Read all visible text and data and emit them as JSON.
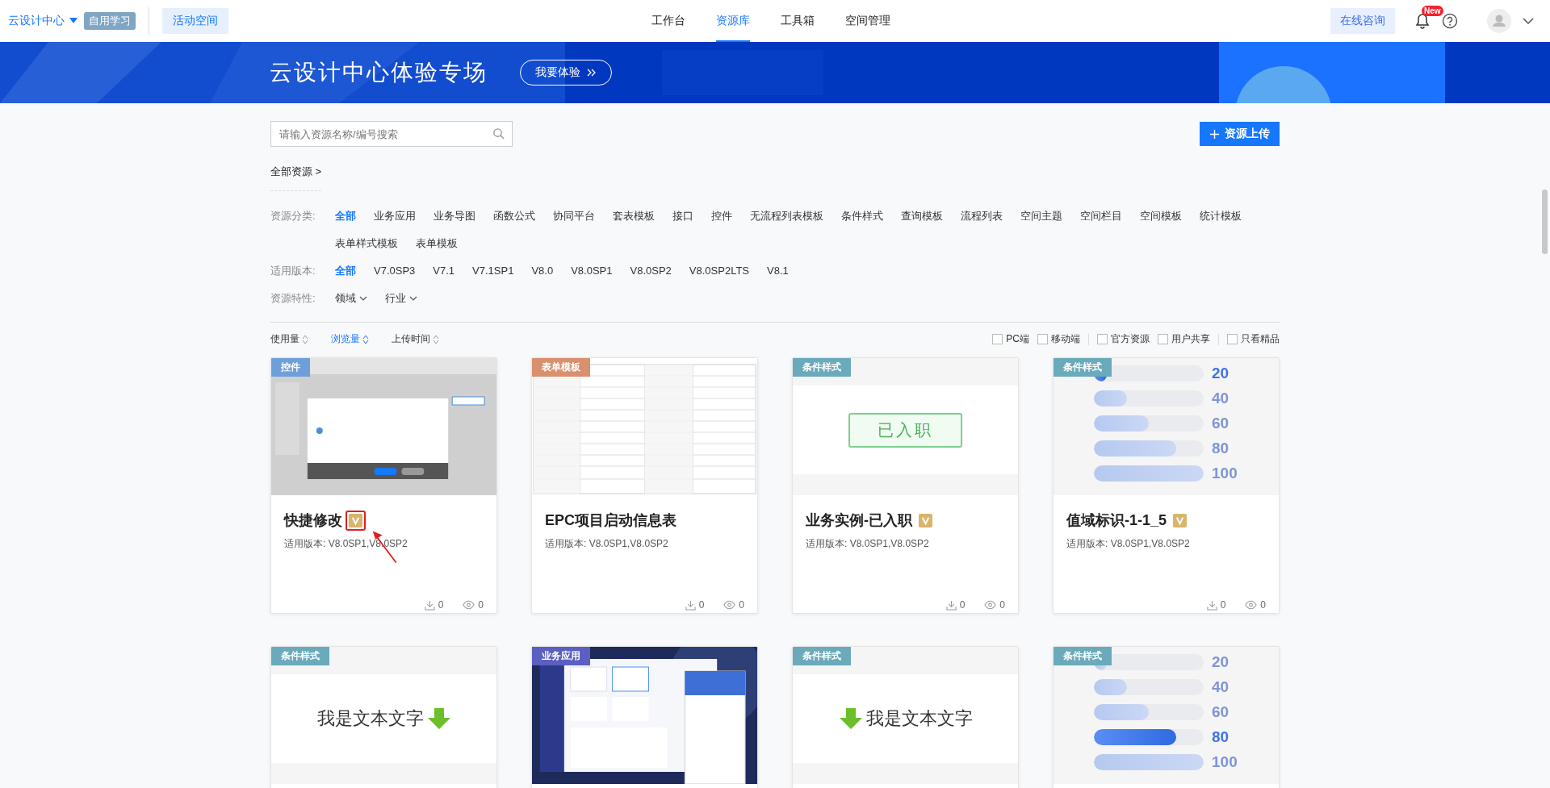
{
  "topbar": {
    "brand": "云设计中心",
    "brand_tag": "自用学习",
    "space_button": "活动空间",
    "nav": [
      {
        "label": "工作台",
        "selected": false
      },
      {
        "label": "资源库",
        "selected": true
      },
      {
        "label": "工具箱",
        "selected": false
      },
      {
        "label": "空间管理",
        "selected": false
      }
    ],
    "consult_button": "在线咨询",
    "bell_badge": "New"
  },
  "banner": {
    "title": "云设计中心体验专场",
    "button": "我要体验"
  },
  "search": {
    "placeholder": "请输入资源名称/编号搜索"
  },
  "upload_button": "资源上传",
  "breadcrumb": "全部资源 >",
  "filters": [
    {
      "label": "资源分类:",
      "kind": "tags",
      "options": [
        {
          "label": "全部",
          "selected": true
        },
        {
          "label": "业务应用",
          "selected": false
        },
        {
          "label": "业务导图",
          "selected": false
        },
        {
          "label": "函数公式",
          "selected": false
        },
        {
          "label": "协同平台",
          "selected": false
        },
        {
          "label": "套表模板",
          "selected": false
        },
        {
          "label": "接口",
          "selected": false
        },
        {
          "label": "控件",
          "selected": false
        },
        {
          "label": "无流程列表模板",
          "selected": false
        },
        {
          "label": "条件样式",
          "selected": false
        },
        {
          "label": "查询模板",
          "selected": false
        },
        {
          "label": "流程列表",
          "selected": false
        },
        {
          "label": "空间主题",
          "selected": false
        },
        {
          "label": "空间栏目",
          "selected": false
        },
        {
          "label": "空间模板",
          "selected": false
        },
        {
          "label": "统计模板",
          "selected": false
        },
        {
          "label": "表单样式模板",
          "selected": false
        },
        {
          "label": "表单模板",
          "selected": false
        }
      ]
    },
    {
      "label": "适用版本:",
      "kind": "tags",
      "options": [
        {
          "label": "全部",
          "selected": true
        },
        {
          "label": "V7.0SP3",
          "selected": false
        },
        {
          "label": "V7.1",
          "selected": false
        },
        {
          "label": "V7.1SP1",
          "selected": false
        },
        {
          "label": "V8.0",
          "selected": false
        },
        {
          "label": "V8.0SP1",
          "selected": false
        },
        {
          "label": "V8.0SP2",
          "selected": false
        },
        {
          "label": "V8.0SP2LTS",
          "selected": false
        },
        {
          "label": "V8.1",
          "selected": false
        }
      ]
    },
    {
      "label": "资源特性:",
      "kind": "dropdowns",
      "options": [
        {
          "label": "领域",
          "selected": false
        },
        {
          "label": "行业",
          "selected": false
        }
      ]
    }
  ],
  "sort": [
    {
      "label": "使用量",
      "selected": false
    },
    {
      "label": "浏览量",
      "selected": true
    },
    {
      "label": "上传时间",
      "selected": false
    }
  ],
  "checkbox_groups": [
    [
      {
        "label": "PC端",
        "checked": false
      },
      {
        "label": "移动端",
        "checked": false
      }
    ],
    [
      {
        "label": "官方资源",
        "checked": false
      },
      {
        "label": "用户共享",
        "checked": false
      }
    ],
    [
      {
        "label": "只看精品",
        "checked": false
      }
    ]
  ],
  "cards": [
    {
      "tag": "控件",
      "color": "#6f9fd8",
      "thumb": {
        "kind": "screen"
      },
      "title": "快捷修改",
      "premium": true,
      "annotated": true,
      "version": "适用版本:  V8.0SP1,V8.0SP2",
      "downloads": "0",
      "views": "0"
    },
    {
      "tag": "表单模板",
      "color": "#d9906f",
      "thumb": {
        "kind": "form"
      },
      "title": "EPC项目启动信息表",
      "premium": false,
      "annotated": false,
      "version": "适用版本:  V8.0SP1,V8.0SP2",
      "downloads": "0",
      "views": "0"
    },
    {
      "tag": "条件样式",
      "color": "#6aaabb",
      "thumb": {
        "kind": "status",
        "text": "已入职"
      },
      "title": "业务实例-已入职",
      "premium": true,
      "annotated": false,
      "version": "适用版本:  V8.0SP1,V8.0SP2",
      "downloads": "0",
      "views": "0"
    },
    {
      "tag": "条件样式",
      "color": "#6aaabb",
      "thumb": {
        "kind": "bars",
        "bars": [
          {
            "label": "20",
            "level": 0.12,
            "selected": true
          },
          {
            "label": "40",
            "level": 0.3,
            "selected": false
          },
          {
            "label": "60",
            "level": 0.5,
            "selected": false
          },
          {
            "label": "80",
            "level": 0.75,
            "selected": false
          },
          {
            "label": "100",
            "level": 1,
            "selected": false
          }
        ]
      },
      "title": "值域标识-1-1_5",
      "premium": true,
      "annotated": false,
      "version": "适用版本:  V8.0SP1,V8.0SP2",
      "downloads": "0",
      "views": "0"
    },
    {
      "tag": "条件样式",
      "color": "#6aaabb",
      "thumb": {
        "kind": "text_arrow",
        "text": "我是文本文字"
      }
    },
    {
      "tag": "业务应用",
      "color": "#5a5fc0",
      "thumb": {
        "kind": "dashboard"
      }
    },
    {
      "tag": "条件样式",
      "color": "#6aaabb",
      "thumb": {
        "kind": "arrow_text",
        "text": "我是文本文字"
      }
    },
    {
      "tag": "条件样式",
      "color": "#6aaabb",
      "thumb": {
        "kind": "bars",
        "bars": [
          {
            "label": "20",
            "level": 0.12,
            "selected": false
          },
          {
            "label": "40",
            "level": 0.3,
            "selected": false
          },
          {
            "label": "60",
            "level": 0.5,
            "selected": false
          },
          {
            "label": "80",
            "level": 0.75,
            "selected": true
          },
          {
            "label": "100",
            "level": 1,
            "selected": false
          }
        ]
      }
    }
  ]
}
